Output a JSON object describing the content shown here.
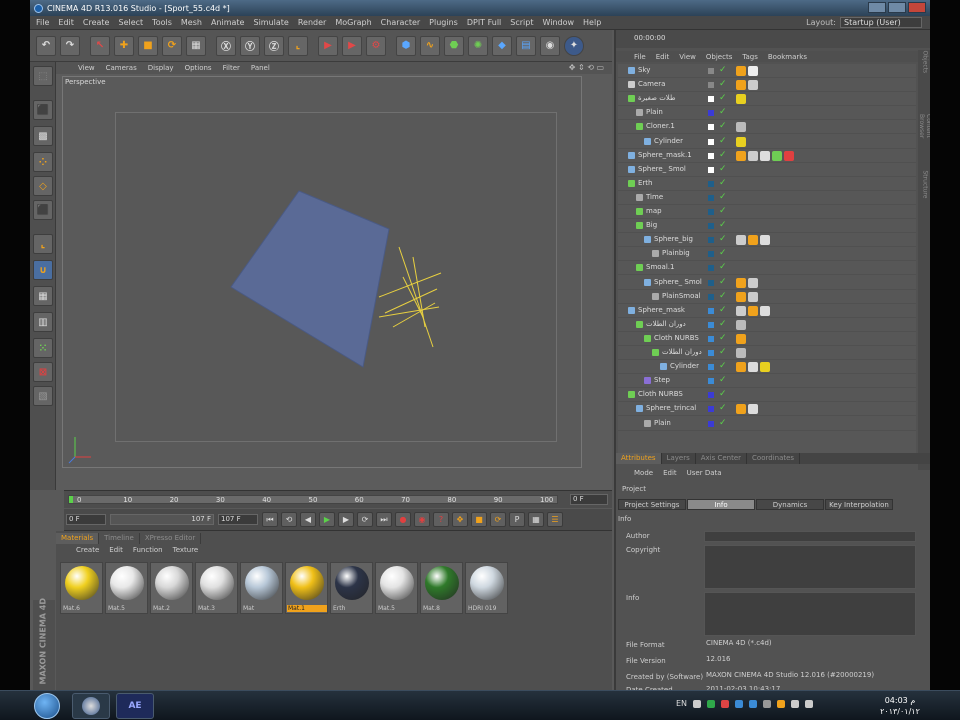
{
  "window": {
    "title": "CINEMA 4D R13.016 Studio - [Sport_55.c4d *]"
  },
  "menubar": [
    "File",
    "Edit",
    "Create",
    "Select",
    "Tools",
    "Mesh",
    "Animate",
    "Simulate",
    "Render",
    "MoGraph",
    "Character",
    "Plugins",
    "DPIT Full",
    "Script",
    "Window",
    "Help"
  ],
  "layout": {
    "label": "Layout:",
    "value": "Startup (User)"
  },
  "viewport": {
    "menu": [
      "View",
      "Cameras",
      "Display",
      "Options",
      "Filter",
      "Panel"
    ],
    "label": "Perspective"
  },
  "timeline": {
    "ticks": [
      "0",
      "10",
      "20",
      "30",
      "40",
      "50",
      "60",
      "70",
      "80",
      "90",
      "100"
    ],
    "frame_box": "0 F",
    "start_field": "0 F",
    "range_field": "107 F",
    "end_field": "107 F"
  },
  "materials": {
    "tabs": [
      "Materials",
      "Timeline",
      "XPresso Editor"
    ],
    "menu": [
      "Create",
      "Edit",
      "Function",
      "Texture"
    ],
    "items": [
      {
        "name": "Mat.6",
        "color": "#f0d020"
      },
      {
        "name": "Mat.5",
        "color": "#e8e8e8"
      },
      {
        "name": "Mat.2",
        "color": "#d8d8d8"
      },
      {
        "name": "Mat.3",
        "color": "#e0e0e0"
      },
      {
        "name": "Mat",
        "color": "#b8c8d8"
      },
      {
        "name": "Mat.1",
        "color": "#f0c018",
        "selected": true
      },
      {
        "name": "Erth",
        "color": "#2c3448"
      },
      {
        "name": "Mat.5",
        "color": "#e4e4e4"
      },
      {
        "name": "Mat.8",
        "color": "#2f7a2a"
      },
      {
        "name": "HDRI 019",
        "color": "#cfd8e0"
      }
    ]
  },
  "brand": "MAXON CINEMA 4D",
  "objects": {
    "time": "00:00:00",
    "menu": [
      "File",
      "Edit",
      "View",
      "Objects",
      "Tags",
      "Bookmarks"
    ],
    "rows": [
      {
        "name": "Sky",
        "indent": 0,
        "icon": "#7fb0e0",
        "flag": "#888"
      },
      {
        "name": "Camera",
        "indent": 0,
        "icon": "#cccccc",
        "flag": "#888"
      },
      {
        "name": "طلات صغيرة",
        "indent": 0,
        "icon": "#6fce54",
        "flag": "#fff"
      },
      {
        "name": "Plain",
        "indent": 1,
        "icon": "#aaaaaa",
        "flag": "#3b3bd6"
      },
      {
        "name": "Cloner.1",
        "indent": 1,
        "icon": "#6fce54",
        "flag": "#fff"
      },
      {
        "name": "Cylinder",
        "indent": 2,
        "icon": "#7fb0e0",
        "flag": "#fff"
      },
      {
        "name": "Sphere_mask.1",
        "indent": 0,
        "icon": "#7fb0e0",
        "flag": "#fff"
      },
      {
        "name": "Sphere_ Smol",
        "indent": 0,
        "icon": "#7fb0e0",
        "flag": "#fff"
      },
      {
        "name": "Erth",
        "indent": 0,
        "icon": "#6fce54",
        "flag": "#1f5f8a"
      },
      {
        "name": "Time",
        "indent": 1,
        "icon": "#aaaaaa",
        "flag": "#1f5f8a"
      },
      {
        "name": "map",
        "indent": 1,
        "icon": "#6fce54",
        "flag": "#1f5f8a"
      },
      {
        "name": "Big",
        "indent": 1,
        "icon": "#6fce54",
        "flag": "#1f5f8a"
      },
      {
        "name": "Sphere_big",
        "indent": 2,
        "icon": "#7fb0e0",
        "flag": "#1f5f8a"
      },
      {
        "name": "Plainbig",
        "indent": 3,
        "icon": "#aaaaaa",
        "flag": "#1f5f8a"
      },
      {
        "name": "Smoal.1",
        "indent": 1,
        "icon": "#6fce54",
        "flag": "#1f5f8a"
      },
      {
        "name": "Sphere_ Smol",
        "indent": 2,
        "icon": "#7fb0e0",
        "flag": "#1f5f8a"
      },
      {
        "name": "PlainSmoal",
        "indent": 3,
        "icon": "#aaaaaa",
        "flag": "#1f5f8a"
      },
      {
        "name": "Sphere_mask",
        "indent": 0,
        "icon": "#7fb0e0",
        "flag": "#3b8bd6"
      },
      {
        "name": "دوران الطلات",
        "indent": 1,
        "icon": "#6fce54",
        "flag": "#3b8bd6"
      },
      {
        "name": "Cloth NURBS",
        "indent": 2,
        "icon": "#6fce54",
        "flag": "#3b8bd6"
      },
      {
        "name": "دوران الطلات",
        "indent": 3,
        "icon": "#6fce54",
        "flag": "#3b8bd6"
      },
      {
        "name": "Cylinder",
        "indent": 4,
        "icon": "#7fb0e0",
        "flag": "#3b8bd6"
      },
      {
        "name": "Step",
        "indent": 2,
        "icon": "#8a6fd6",
        "flag": "#3b8bd6"
      },
      {
        "name": "Cloth NURBS",
        "indent": 0,
        "icon": "#6fce54",
        "flag": "#3b3bd6"
      },
      {
        "name": "Sphere_trincal",
        "indent": 1,
        "icon": "#7fb0e0",
        "flag": "#3b3bd6"
      },
      {
        "name": "Plain",
        "indent": 2,
        "icon": "#aaaaaa",
        "flag": "#3b3bd6"
      }
    ],
    "side_tabs": [
      "Objects",
      "Content Browser",
      "Structure"
    ]
  },
  "attributes": {
    "tabs": [
      "Attributes",
      "Layers",
      "Axis Center",
      "Coordinates"
    ],
    "menu": [
      "Mode",
      "Edit",
      "User Data"
    ],
    "object": "Project",
    "subtabs": [
      "Project Settings",
      "Info",
      "Dynamics",
      "Key Interpolation"
    ],
    "section": "Info",
    "fields": {
      "author": "Author",
      "copyright": "Copyright",
      "info": "Info",
      "file_format_label": "File Format",
      "file_format": "CINEMA 4D (*.c4d)",
      "file_version_label": "File Version",
      "file_version": "12.016",
      "created_by_label": "Created by (Software)",
      "created_by": "MAXON CINEMA 4D Studio 12.016 (#20000219)",
      "date_label": "Date Created",
      "date": "2011-02-03 10:43:17"
    }
  },
  "taskbar": {
    "lang": "EN",
    "time": "04:03 م",
    "date": "٢٠١٣/٠١/١٢",
    "ae_label": "AE"
  }
}
